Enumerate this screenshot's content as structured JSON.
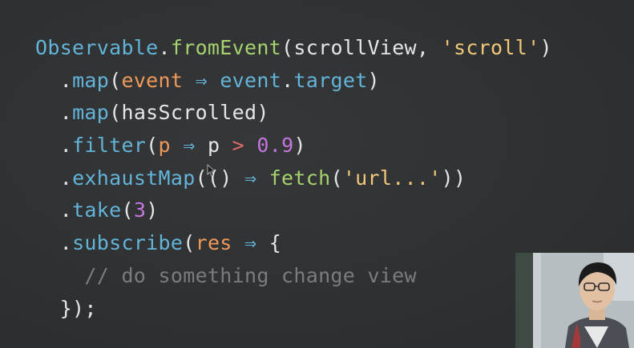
{
  "code_lines": [
    {
      "tokens": [
        {
          "t": "Observable",
          "c": "class"
        },
        {
          "t": ".",
          "c": "punct"
        },
        {
          "t": "fromEvent",
          "c": "method"
        },
        {
          "t": "(scrollView, ",
          "c": "plain"
        },
        {
          "t": "'scroll'",
          "c": "string"
        },
        {
          "t": ")",
          "c": "plain"
        }
      ]
    },
    {
      "tokens": [
        {
          "t": "  .",
          "c": "punct"
        },
        {
          "t": "map",
          "c": "prop"
        },
        {
          "t": "(",
          "c": "plain"
        },
        {
          "t": "event",
          "c": "param"
        },
        {
          "t": " ⇒ ",
          "c": "op"
        },
        {
          "t": "event",
          "c": "prop"
        },
        {
          "t": ".",
          "c": "punct"
        },
        {
          "t": "target",
          "c": "prop"
        },
        {
          "t": ")",
          "c": "plain"
        }
      ]
    },
    {
      "tokens": [
        {
          "t": "  .",
          "c": "punct"
        },
        {
          "t": "map",
          "c": "prop"
        },
        {
          "t": "(hasScrolled)",
          "c": "plain"
        }
      ]
    },
    {
      "tokens": [
        {
          "t": "  .",
          "c": "punct"
        },
        {
          "t": "filter",
          "c": "prop"
        },
        {
          "t": "(",
          "c": "plain"
        },
        {
          "t": "p",
          "c": "param"
        },
        {
          "t": " ⇒ ",
          "c": "op"
        },
        {
          "t": "p ",
          "c": "plain"
        },
        {
          "t": ">",
          "c": "keyword"
        },
        {
          "t": " ",
          "c": "plain"
        },
        {
          "t": "0.9",
          "c": "number"
        },
        {
          "t": ")",
          "c": "plain"
        }
      ]
    },
    {
      "tokens": [
        {
          "t": "  .",
          "c": "punct"
        },
        {
          "t": "exhaustMap",
          "c": "prop"
        },
        {
          "t": "(() ",
          "c": "plain"
        },
        {
          "t": "⇒",
          "c": "op"
        },
        {
          "t": " ",
          "c": "plain"
        },
        {
          "t": "fetch",
          "c": "method"
        },
        {
          "t": "(",
          "c": "plain"
        },
        {
          "t": "'url...'",
          "c": "string"
        },
        {
          "t": "))",
          "c": "plain"
        }
      ]
    },
    {
      "tokens": [
        {
          "t": "  .",
          "c": "punct"
        },
        {
          "t": "take",
          "c": "prop"
        },
        {
          "t": "(",
          "c": "plain"
        },
        {
          "t": "3",
          "c": "number"
        },
        {
          "t": ")",
          "c": "plain"
        }
      ]
    },
    {
      "tokens": [
        {
          "t": "  .",
          "c": "punct"
        },
        {
          "t": "subscribe",
          "c": "prop"
        },
        {
          "t": "(",
          "c": "plain"
        },
        {
          "t": "res",
          "c": "param"
        },
        {
          "t": " ⇒ ",
          "c": "op"
        },
        {
          "t": "{",
          "c": "plain"
        }
      ]
    },
    {
      "tokens": [
        {
          "t": "    // do something change view",
          "c": "comment"
        }
      ]
    },
    {
      "tokens": [
        {
          "t": "  });",
          "c": "plain"
        }
      ]
    }
  ],
  "colors": {
    "background": "#2f3133",
    "class": "#63b4d9",
    "method": "#a6d36e",
    "string": "#f2c779",
    "number": "#c377dd",
    "param": "#f09a5a",
    "comment": "#7a7d80"
  },
  "icons": {
    "cursor": "mouse-pointer-icon"
  },
  "overlay": {
    "type": "speaker-webcam"
  }
}
